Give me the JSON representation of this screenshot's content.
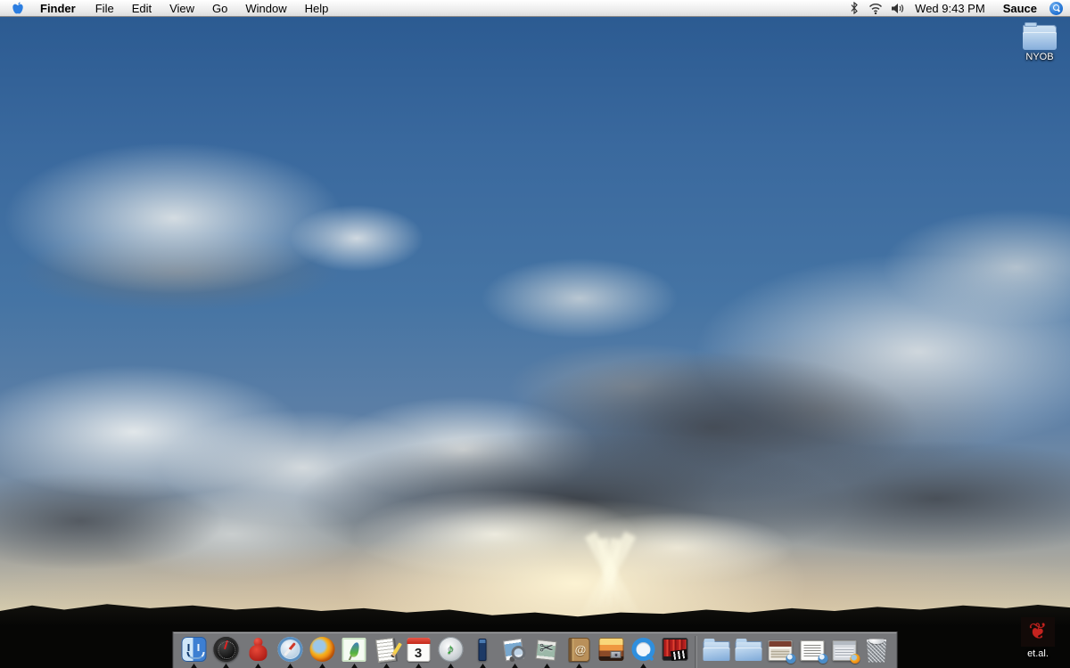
{
  "menu_bar": {
    "active_app": "Finder",
    "menus": [
      "Finder",
      "File",
      "Edit",
      "View",
      "Go",
      "Window",
      "Help"
    ],
    "clock": "Wed 9:43 PM",
    "user": "Sauce",
    "status_icons": [
      "bluetooth-icon",
      "wifi-icon",
      "volume-icon",
      "spotlight-icon"
    ],
    "apple_logo_color": "#2b7de0"
  },
  "desktop": {
    "icons": [
      {
        "label": "NYOB",
        "kind": "folder"
      },
      {
        "label": "et.al.",
        "kind": "red-ornament-image"
      }
    ]
  },
  "dock": {
    "ical_day": "3",
    "itunes_note": "♪",
    "address_book_at": "@",
    "apps": [
      {
        "icon": "finder-icon",
        "running": true
      },
      {
        "icon": "dashboard-icon",
        "running": true
      },
      {
        "icon": "red-figure-app-icon",
        "running": true
      },
      {
        "icon": "safari-icon",
        "running": true
      },
      {
        "icon": "firefox-icon",
        "running": true
      },
      {
        "icon": "texshop-feather-icon",
        "running": true
      },
      {
        "icon": "textedit-icon",
        "running": true
      },
      {
        "icon": "ical-icon",
        "running": true
      },
      {
        "icon": "itunes-icon",
        "running": true
      },
      {
        "icon": "quinn-tetris-icon",
        "running": true
      },
      {
        "icon": "preview-icon",
        "running": true
      },
      {
        "icon": "grab-scissors-icon",
        "running": true
      },
      {
        "icon": "address-book-icon",
        "running": true
      },
      {
        "icon": "iphoto-icon",
        "running": false
      },
      {
        "icon": "quicktime-icon",
        "running": true
      },
      {
        "icon": "dvd-player-icon",
        "running": false
      }
    ],
    "right_items": [
      "folder-icon",
      "folder-icon",
      "minimized-safari-window",
      "minimized-document-window",
      "minimized-firefox-window",
      "trash-full-icon"
    ]
  },
  "wallpaper": {
    "colors": {
      "sky_top": "#2a5990",
      "sky_mid": "#4574a4",
      "sun_glow": "#fff6d6",
      "treeline": "#0a0a07"
    }
  }
}
